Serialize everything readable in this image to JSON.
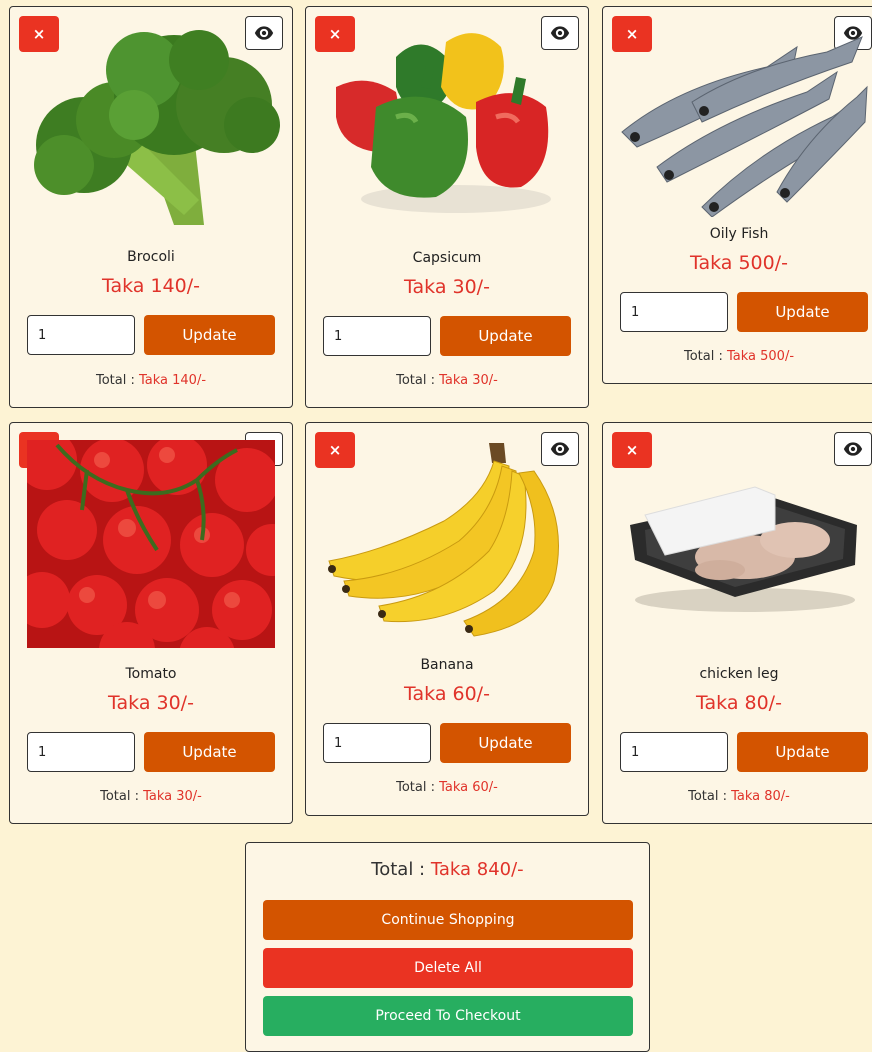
{
  "products": [
    {
      "name": "Brocoli",
      "price": "Taka 140/-",
      "qty": "1",
      "update_label": "Update",
      "total_label": "Total :",
      "total_value": "Taka 140/-",
      "delete_glyph": "×",
      "image_icon": "broccoli-image",
      "view_icon": "eye-icon"
    },
    {
      "name": "Capsicum",
      "price": "Taka 30/-",
      "qty": "1",
      "update_label": "Update",
      "total_label": "Total :",
      "total_value": "Taka 30/-",
      "delete_glyph": "×",
      "image_icon": "capsicum-image",
      "view_icon": "eye-icon"
    },
    {
      "name": "Oily Fish",
      "price": "Taka 500/-",
      "qty": "1",
      "update_label": "Update",
      "total_label": "Total :",
      "total_value": "Taka 500/-",
      "delete_glyph": "×",
      "image_icon": "fish-image",
      "view_icon": "eye-icon"
    },
    {
      "name": "Tomato",
      "price": "Taka 30/-",
      "qty": "1",
      "update_label": "Update",
      "total_label": "Total :",
      "total_value": "Taka 30/-",
      "delete_glyph": "×",
      "image_icon": "tomato-image",
      "view_icon": "eye-icon"
    },
    {
      "name": "Banana",
      "price": "Taka 60/-",
      "qty": "1",
      "update_label": "Update",
      "total_label": "Total :",
      "total_value": "Taka 60/-",
      "delete_glyph": "×",
      "image_icon": "banana-image",
      "view_icon": "eye-icon"
    },
    {
      "name": "chicken leg",
      "price": "Taka 80/-",
      "qty": "1",
      "update_label": "Update",
      "total_label": "Total :",
      "total_value": "Taka 80/-",
      "delete_glyph": "×",
      "image_icon": "chicken-leg-image",
      "view_icon": "eye-icon"
    }
  ],
  "summary": {
    "total_label": "Total :",
    "total_value": "Taka 840/-",
    "continue_label": "Continue Shopping",
    "delete_all_label": "Delete All",
    "checkout_label": "Proceed To Checkout"
  },
  "colors": {
    "page_bg": "#fdf3d4",
    "card_bg": "#fdf6e5",
    "delete_red": "#ea3322",
    "update_orange": "#d35400",
    "price_red": "#e0332a",
    "checkout_green": "#27ae60"
  }
}
